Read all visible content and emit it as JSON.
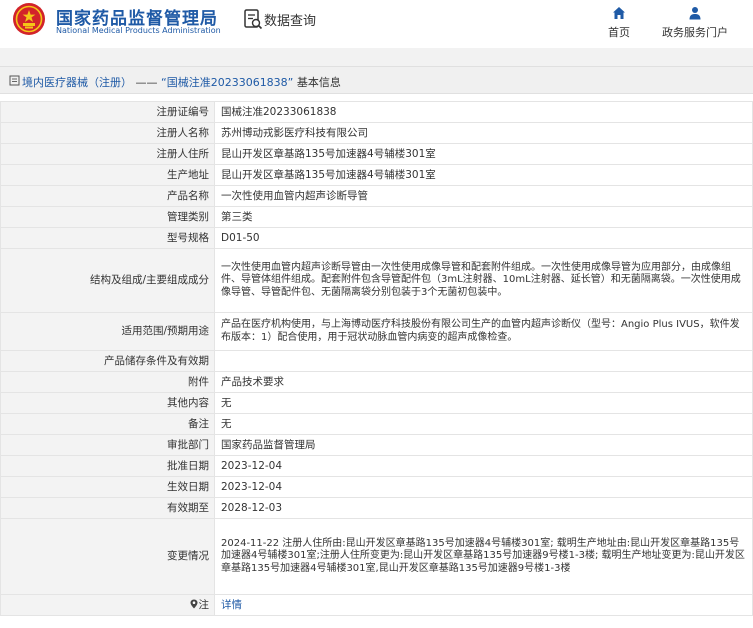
{
  "header": {
    "brand_cn": "国家药品监督管理局",
    "brand_en": "National Medical Products Administration",
    "section_title": "数据查询",
    "nav": [
      {
        "label": "首页",
        "icon": "home-icon"
      },
      {
        "label": "政务服务门户",
        "icon": "user-icon"
      }
    ]
  },
  "breadcrumb": {
    "category": "境内医疗器械（注册）",
    "separator": "——",
    "registration": "“国械注准20233061838”",
    "suffix": "基本信息"
  },
  "fields": [
    {
      "label": "注册证编号",
      "value": "国械注准20233061838"
    },
    {
      "label": "注册人名称",
      "value": "苏州博动戎影医疗科技有限公司"
    },
    {
      "label": "注册人住所",
      "value": "昆山开发区章基路135号加速器4号辅楼301室"
    },
    {
      "label": "生产地址",
      "value": "昆山开发区章基路135号加速器4号辅楼301室"
    },
    {
      "label": "产品名称",
      "value": "一次性使用血管内超声诊断导管"
    },
    {
      "label": "管理类别",
      "value": "第三类"
    },
    {
      "label": "型号规格",
      "value": "D01-50"
    },
    {
      "label": "结构及组成/主要组成成分",
      "value": "一次性使用血管内超声诊断导管由一次性使用成像导管和配套附件组成。一次性使用成像导管为应用部分，由成像组件、导管体组件组成。配套附件包含导管配件包（3mL注射器、10mL注射器、延长管）和无菌隔离袋。一次性使用成像导管、导管配件包、无菌隔离袋分别包装于3个无菌初包装中。"
    },
    {
      "label": "适用范围/预期用途",
      "value": "产品在医疗机构使用，与上海博动医疗科技股份有限公司生产的血管内超声诊断仪（型号：Angio Plus IVUS，软件发布版本：1）配合使用，用于冠状动脉血管内病变的超声成像检查。"
    },
    {
      "label": "产品储存条件及有效期",
      "value": ""
    },
    {
      "label": "附件",
      "value": "产品技术要求"
    },
    {
      "label": "其他内容",
      "value": "无"
    },
    {
      "label": "备注",
      "value": "无"
    },
    {
      "label": "审批部门",
      "value": "国家药品监督管理局"
    },
    {
      "label": "批准日期",
      "value": "2023-12-04"
    },
    {
      "label": "生效日期",
      "value": "2023-12-04"
    },
    {
      "label": "有效期至",
      "value": "2028-12-03"
    },
    {
      "label": "变更情况",
      "value": "2024-11-22 注册人住所由:昆山开发区章基路135号加速器4号辅楼301室; 载明生产地址由:昆山开发区章基路135号加速器4号辅楼301室;注册人住所变更为:昆山开发区章基路135号加速器9号楼1-3楼; 载明生产地址变更为:昆山开发区章基路135号加速器4号辅楼301室,昆山开发区章基路135号加速器9号楼1-3楼"
    }
  ],
  "note": {
    "label": "注",
    "link_text": "详情"
  },
  "colors": {
    "brand_blue": "#1f5aa6",
    "label_bg": "#f3f3f3",
    "border": "#e4e4e4"
  }
}
